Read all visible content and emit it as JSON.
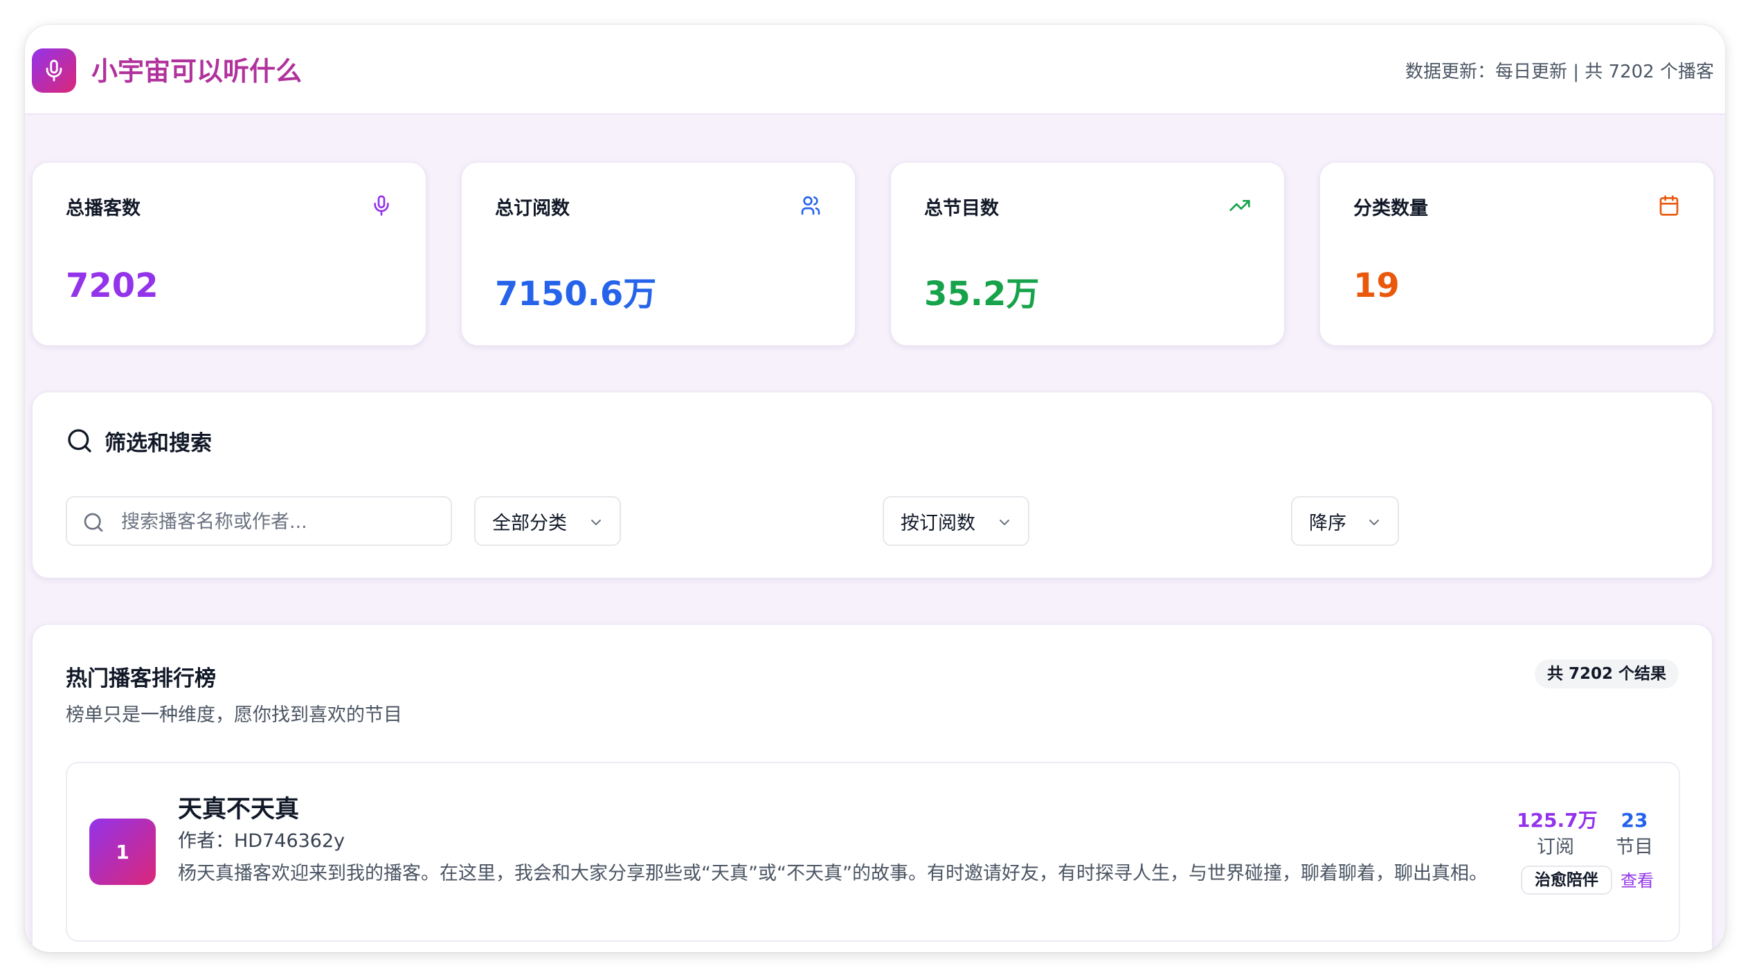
{
  "header": {
    "title": "小宇宙可以听什么",
    "update_info": "数据更新：每日更新 | 共 7202 个播客"
  },
  "stats": [
    {
      "label": "总播客数",
      "value": "7202",
      "icon": "microphone-icon",
      "color": "#9333ea"
    },
    {
      "label": "总订阅数",
      "value": "7150.6万",
      "icon": "users-icon",
      "color": "#2563eb"
    },
    {
      "label": "总节目数",
      "value": "35.2万",
      "icon": "trending-up-icon",
      "color": "#16a34a"
    },
    {
      "label": "分类数量",
      "value": "19",
      "icon": "calendar-icon",
      "color": "#ea580c"
    }
  ],
  "filter": {
    "title": "筛选和搜索",
    "search_placeholder": "搜索播客名称或作者...",
    "category_select": "全部分类",
    "sort_select": "按订阅数",
    "order_select": "降序"
  },
  "ranking": {
    "title": "热门播客排行榜",
    "subtitle": "榜单只是一种维度，愿你找到喜欢的节目",
    "result_count": "共 7202 个结果",
    "items": [
      {
        "rank": "1",
        "name": "天真不天真",
        "author": "作者：HD746362y",
        "description": "杨天真播客欢迎来到我的播客。在这里，我会和大家分享那些或“天真”或“不天真”的故事。有时邀请好友，有时探寻人生，与世界碰撞，聊着聊着，聊出真相。",
        "subscribers": "125.7万",
        "subscribers_label": "订阅",
        "episodes": "23",
        "episodes_label": "节目",
        "tag": "治愈陪伴",
        "view_label": "查看"
      }
    ]
  },
  "colors": {
    "brand_gradient_start": "#9333ea",
    "brand_gradient_end": "#db2777",
    "title_color": "#b0329c"
  }
}
